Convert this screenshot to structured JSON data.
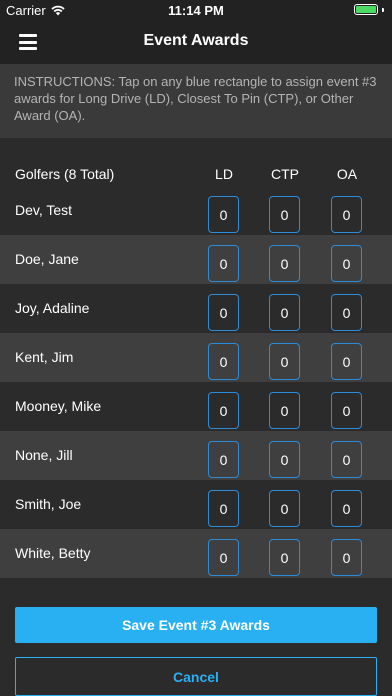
{
  "status_bar": {
    "carrier": "Carrier",
    "time": "11:14 PM"
  },
  "nav": {
    "title": "Event Awards"
  },
  "instructions": "INSTRUCTIONS: Tap on any blue rectangle to assign event #3 awards for Long Drive (LD), Closest To Pin (CTP), or Other Award (OA).",
  "table": {
    "golfers_header": "Golfers (8 Total)",
    "col_ld": "LD",
    "col_ctp": "CTP",
    "col_oa": "OA",
    "rows": [
      {
        "name": "Dev, Test",
        "ld": "0",
        "ctp": "0",
        "oa": "0"
      },
      {
        "name": "Doe, Jane",
        "ld": "0",
        "ctp": "0",
        "oa": "0"
      },
      {
        "name": "Joy, Adaline",
        "ld": "0",
        "ctp": "0",
        "oa": "0"
      },
      {
        "name": "Kent, Jim",
        "ld": "0",
        "ctp": "0",
        "oa": "0"
      },
      {
        "name": "Mooney, Mike",
        "ld": "0",
        "ctp": "0",
        "oa": "0"
      },
      {
        "name": "None, Jill",
        "ld": "0",
        "ctp": "0",
        "oa": "0"
      },
      {
        "name": "Smith, Joe",
        "ld": "0",
        "ctp": "0",
        "oa": "0"
      },
      {
        "name": "White, Betty",
        "ld": "0",
        "ctp": "0",
        "oa": "0"
      }
    ]
  },
  "buttons": {
    "save_label": "Save Event #3 Awards",
    "cancel_label": "Cancel"
  },
  "colors": {
    "accent": "#29b0f2",
    "box_border": "#2d8cd8",
    "battery": "#4cd964"
  }
}
